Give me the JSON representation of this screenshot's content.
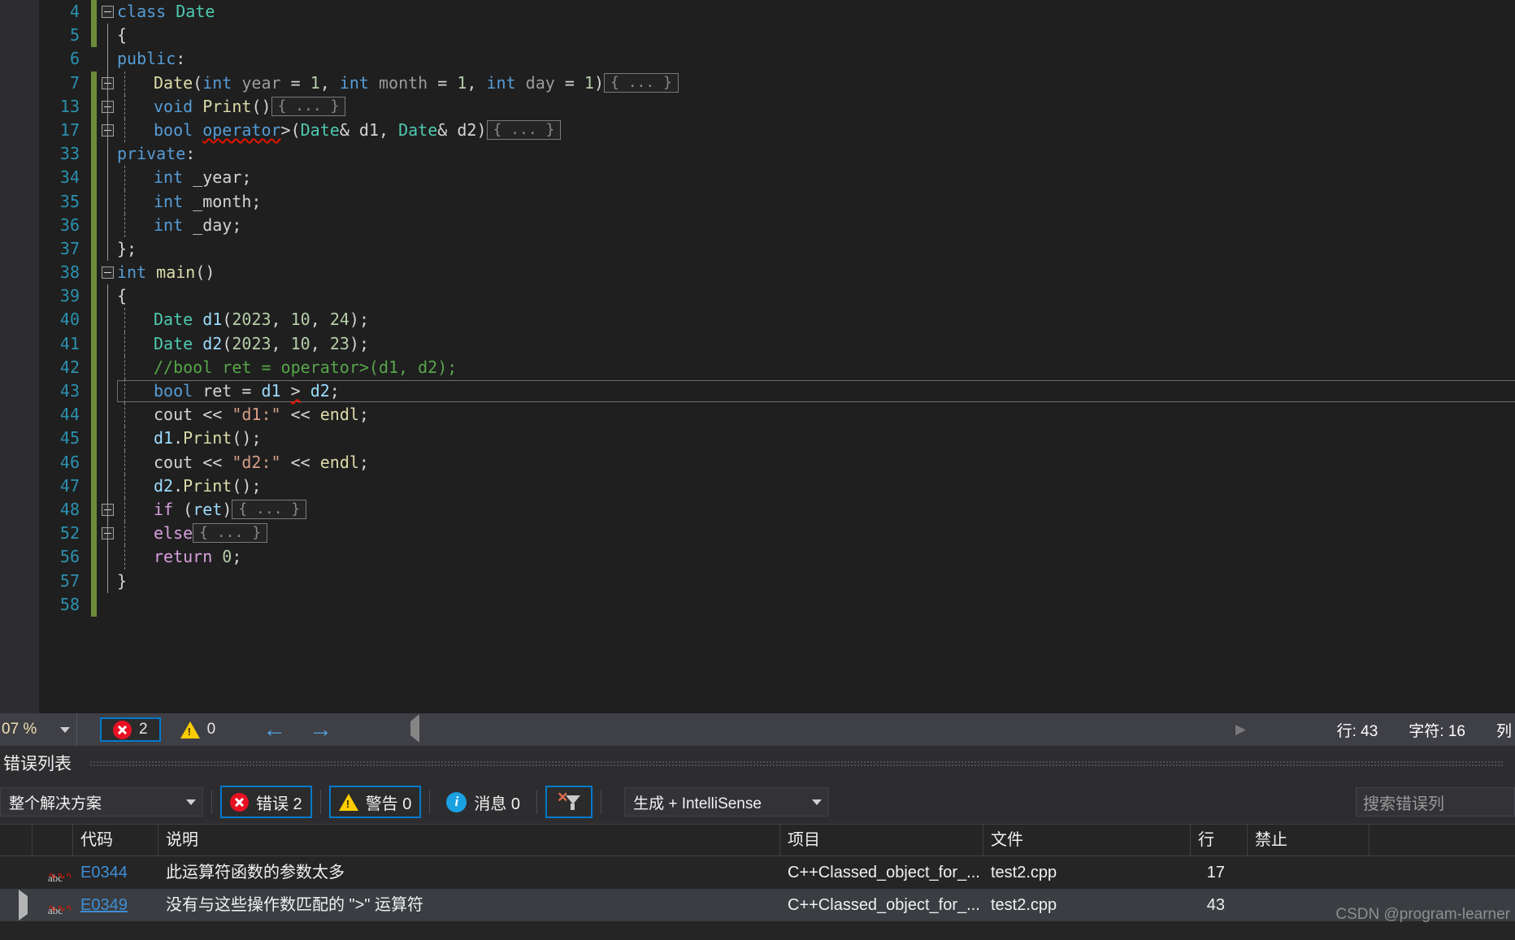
{
  "editor": {
    "lines": [
      {
        "num": "4",
        "glyph": "minus",
        "indent": 0,
        "guide": "none",
        "changed": true,
        "tokens": [
          {
            "t": "class ",
            "c": "kw"
          },
          {
            "t": "Date",
            "c": "type"
          }
        ]
      },
      {
        "num": "5",
        "glyph": "",
        "indent": 0,
        "guide": "solid",
        "changed": true,
        "tokens": [
          {
            "t": "{",
            "c": "pun"
          }
        ]
      },
      {
        "num": "6",
        "glyph": "",
        "indent": 0,
        "guide": "solid",
        "changed": false,
        "tokens": [
          {
            "t": "public",
            "c": "kw"
          },
          {
            "t": ":",
            "c": "pun"
          }
        ]
      },
      {
        "num": "7",
        "glyph": "plus",
        "indent": 1,
        "guide": "dash",
        "changed": true,
        "tokens": [
          {
            "t": "Date",
            "c": "fn"
          },
          {
            "t": "(",
            "c": "pun"
          },
          {
            "t": "int",
            "c": "kw"
          },
          {
            "t": " year ",
            "c": "gray"
          },
          {
            "t": "= ",
            "c": "pun"
          },
          {
            "t": "1",
            "c": "num"
          },
          {
            "t": ", ",
            "c": "pun"
          },
          {
            "t": "int",
            "c": "kw"
          },
          {
            "t": " month ",
            "c": "gray"
          },
          {
            "t": "= ",
            "c": "pun"
          },
          {
            "t": "1",
            "c": "num"
          },
          {
            "t": ", ",
            "c": "pun"
          },
          {
            "t": "int",
            "c": "kw"
          },
          {
            "t": " day ",
            "c": "gray"
          },
          {
            "t": "= ",
            "c": "pun"
          },
          {
            "t": "1",
            "c": "num"
          },
          {
            "t": ")",
            "c": "pun"
          }
        ],
        "collapsed": "{ ... }"
      },
      {
        "num": "13",
        "glyph": "plus",
        "indent": 1,
        "guide": "dash",
        "changed": true,
        "tokens": [
          {
            "t": "void",
            "c": "kw"
          },
          {
            "t": " ",
            "c": "pun"
          },
          {
            "t": "Print",
            "c": "fn"
          },
          {
            "t": "()",
            "c": "pun"
          }
        ],
        "collapsed": "{ ... }"
      },
      {
        "num": "17",
        "glyph": "plus",
        "indent": 1,
        "guide": "dash",
        "changed": true,
        "tokens": [
          {
            "t": "bool",
            "c": "kw"
          },
          {
            "t": " ",
            "c": "pun"
          },
          {
            "t": "operator",
            "c": "kw squiggle"
          },
          {
            "t": ">(",
            "c": "pun"
          },
          {
            "t": "Date",
            "c": "type"
          },
          {
            "t": "& ",
            "c": "pun"
          },
          {
            "t": "d1",
            "c": "pun"
          },
          {
            "t": ", ",
            "c": "pun"
          },
          {
            "t": "Date",
            "c": "type"
          },
          {
            "t": "& ",
            "c": "pun"
          },
          {
            "t": "d2",
            "c": "pun"
          },
          {
            "t": ")",
            "c": "pun"
          }
        ],
        "collapsed": "{ ... }"
      },
      {
        "num": "33",
        "glyph": "",
        "indent": 0,
        "guide": "solid",
        "changed": true,
        "tokens": [
          {
            "t": "private",
            "c": "kw"
          },
          {
            "t": ":",
            "c": "pun"
          }
        ]
      },
      {
        "num": "34",
        "glyph": "",
        "indent": 1,
        "guide": "dash",
        "changed": true,
        "tokens": [
          {
            "t": "int",
            "c": "kw"
          },
          {
            "t": " _year;",
            "c": "pun"
          }
        ]
      },
      {
        "num": "35",
        "glyph": "",
        "indent": 1,
        "guide": "dash",
        "changed": true,
        "tokens": [
          {
            "t": "int",
            "c": "kw"
          },
          {
            "t": " _month;",
            "c": "pun"
          }
        ]
      },
      {
        "num": "36",
        "glyph": "",
        "indent": 1,
        "guide": "dash",
        "changed": true,
        "tokens": [
          {
            "t": "int",
            "c": "kw"
          },
          {
            "t": " _day;",
            "c": "pun"
          }
        ]
      },
      {
        "num": "37",
        "glyph": "",
        "indent": 0,
        "guide": "solid",
        "changed": true,
        "tokens": [
          {
            "t": "};",
            "c": "pun"
          }
        ]
      },
      {
        "num": "38",
        "glyph": "minus",
        "indent": 0,
        "guide": "none",
        "changed": true,
        "tokens": [
          {
            "t": "int",
            "c": "kw"
          },
          {
            "t": " ",
            "c": "pun"
          },
          {
            "t": "main",
            "c": "fn"
          },
          {
            "t": "()",
            "c": "pun"
          }
        ]
      },
      {
        "num": "39",
        "glyph": "",
        "indent": 0,
        "guide": "solid",
        "changed": true,
        "tokens": [
          {
            "t": "{",
            "c": "pun"
          }
        ]
      },
      {
        "num": "40",
        "glyph": "",
        "indent": 1,
        "guide": "dash",
        "changed": true,
        "tokens": [
          {
            "t": "Date",
            "c": "type"
          },
          {
            "t": " ",
            "c": "pun"
          },
          {
            "t": "d1",
            "c": "id"
          },
          {
            "t": "(",
            "c": "pun"
          },
          {
            "t": "2023",
            "c": "num"
          },
          {
            "t": ", ",
            "c": "pun"
          },
          {
            "t": "10",
            "c": "num"
          },
          {
            "t": ", ",
            "c": "pun"
          },
          {
            "t": "24",
            "c": "num"
          },
          {
            "t": ");",
            "c": "pun"
          }
        ]
      },
      {
        "num": "41",
        "glyph": "",
        "indent": 1,
        "guide": "dash",
        "changed": true,
        "tokens": [
          {
            "t": "Date",
            "c": "type"
          },
          {
            "t": " ",
            "c": "pun"
          },
          {
            "t": "d2",
            "c": "id"
          },
          {
            "t": "(",
            "c": "pun"
          },
          {
            "t": "2023",
            "c": "num"
          },
          {
            "t": ", ",
            "c": "pun"
          },
          {
            "t": "10",
            "c": "num"
          },
          {
            "t": ", ",
            "c": "pun"
          },
          {
            "t": "23",
            "c": "num"
          },
          {
            "t": ");",
            "c": "pun"
          }
        ]
      },
      {
        "num": "42",
        "glyph": "",
        "indent": 1,
        "guide": "dash",
        "changed": true,
        "tokens": [
          {
            "t": "//bool ret = operator>(d1, d2);",
            "c": "cmt"
          }
        ]
      },
      {
        "num": "43",
        "glyph": "",
        "indent": 1,
        "guide": "dash",
        "changed": true,
        "current": true,
        "tokens": [
          {
            "t": "bool",
            "c": "kw"
          },
          {
            "t": " ret = ",
            "c": "pun"
          },
          {
            "t": "d1",
            "c": "id"
          },
          {
            "t": " ",
            "c": "pun"
          },
          {
            "t": ">",
            "c": "pun squiggle"
          },
          {
            "t": " ",
            "c": "pun"
          },
          {
            "t": "d2",
            "c": "id"
          },
          {
            "t": ";",
            "c": "pun"
          }
        ]
      },
      {
        "num": "44",
        "glyph": "",
        "indent": 1,
        "guide": "dash",
        "changed": true,
        "tokens": [
          {
            "t": "cout",
            "c": "pun"
          },
          {
            "t": " << ",
            "c": "pun"
          },
          {
            "t": "\"d1:\"",
            "c": "str"
          },
          {
            "t": " << ",
            "c": "pun"
          },
          {
            "t": "endl",
            "c": "fn"
          },
          {
            "t": ";",
            "c": "pun"
          }
        ]
      },
      {
        "num": "45",
        "glyph": "",
        "indent": 1,
        "guide": "dash",
        "changed": true,
        "tokens": [
          {
            "t": "d1",
            "c": "id"
          },
          {
            "t": ".",
            "c": "pun"
          },
          {
            "t": "Print",
            "c": "fn"
          },
          {
            "t": "();",
            "c": "pun"
          }
        ]
      },
      {
        "num": "46",
        "glyph": "",
        "indent": 1,
        "guide": "dash",
        "changed": true,
        "tokens": [
          {
            "t": "cout",
            "c": "pun"
          },
          {
            "t": " << ",
            "c": "pun"
          },
          {
            "t": "\"d2:\"",
            "c": "str"
          },
          {
            "t": " << ",
            "c": "pun"
          },
          {
            "t": "endl",
            "c": "fn"
          },
          {
            "t": ";",
            "c": "pun"
          }
        ]
      },
      {
        "num": "47",
        "glyph": "",
        "indent": 1,
        "guide": "dash",
        "changed": true,
        "tokens": [
          {
            "t": "d2",
            "c": "id"
          },
          {
            "t": ".",
            "c": "pun"
          },
          {
            "t": "Print",
            "c": "fn"
          },
          {
            "t": "();",
            "c": "pun"
          }
        ]
      },
      {
        "num": "48",
        "glyph": "plus",
        "indent": 1,
        "guide": "dash",
        "changed": true,
        "tokens": [
          {
            "t": "if",
            "c": "kw2"
          },
          {
            "t": " (",
            "c": "pun"
          },
          {
            "t": "ret",
            "c": "id"
          },
          {
            "t": ")",
            "c": "pun"
          }
        ],
        "collapsed": "{ ... }"
      },
      {
        "num": "52",
        "glyph": "plus",
        "indent": 1,
        "guide": "dash",
        "changed": true,
        "tokens": [
          {
            "t": "else",
            "c": "kw2"
          }
        ],
        "collapsed": "{ ... }"
      },
      {
        "num": "56",
        "glyph": "",
        "indent": 1,
        "guide": "dash",
        "changed": true,
        "tokens": [
          {
            "t": "return",
            "c": "kw2"
          },
          {
            "t": " ",
            "c": "pun"
          },
          {
            "t": "0",
            "c": "num"
          },
          {
            "t": ";",
            "c": "pun"
          }
        ]
      },
      {
        "num": "57",
        "glyph": "",
        "indent": 0,
        "guide": "solid",
        "changed": true,
        "tokens": [
          {
            "t": "}",
            "c": "pun"
          }
        ]
      },
      {
        "num": "58",
        "glyph": "",
        "indent": 0,
        "guide": "none",
        "changed": true,
        "tokens": []
      }
    ]
  },
  "statusbar": {
    "zoom": "07 %",
    "error_count": "2",
    "warning_count": "0",
    "back_arrow": "←",
    "forward_arrow": "→",
    "line_label": "行: 43",
    "char_label": "字符: 16",
    "extra_label": "列"
  },
  "panel": {
    "tab_title": "错误列表",
    "scope_filter": "整个解决方案",
    "errors_label": "错误 2",
    "warnings_label": "警告 0",
    "messages_label": "消息 0",
    "build_filter": "生成 + IntelliSense",
    "search_placeholder": "搜索错误列",
    "columns": {
      "spacer": "",
      "icon": "",
      "code": "代码",
      "description": "说明",
      "project": "项目",
      "file": "文件",
      "line": "行",
      "suppression": "禁止"
    },
    "rows": [
      {
        "code": "E0344",
        "description": "此运算符函数的参数太多",
        "project": "C++Classed_object_for_...",
        "file": "test2.cpp",
        "line": "17",
        "selected": false,
        "expandable": false
      },
      {
        "code": "E0349",
        "description": "没有与这些操作数匹配的 \">\" 运算符",
        "project": "C++Classed_object_for_...",
        "file": "test2.cpp",
        "line": "43",
        "selected": true,
        "expandable": true
      }
    ]
  },
  "watermark": "CSDN @program-learner"
}
